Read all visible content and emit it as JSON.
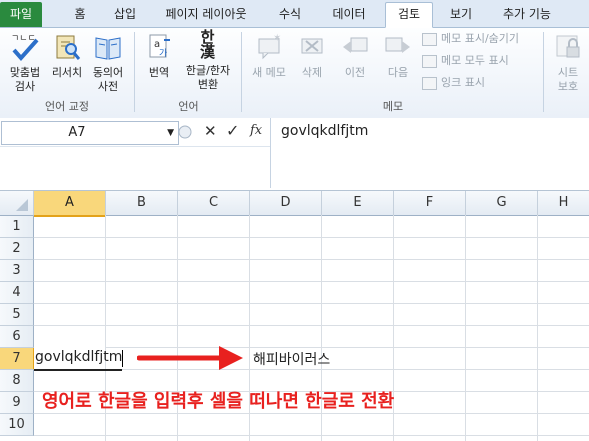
{
  "ribbon_tabs": [
    "파일",
    "홈",
    "삽입",
    "페이지 레이아웃",
    "수식",
    "데이터",
    "검토",
    "보기",
    "추가 기능"
  ],
  "ribbon": {
    "groups": {
      "proofing": {
        "label": "언어 교정",
        "spell_check": "맞춤법\n검사",
        "research": "리서치",
        "thesaurus": "동의어\n사전"
      },
      "language": {
        "label": "언어",
        "translate": "번역",
        "hanja_convert": "한글/한자\n변환",
        "hanja_icon_glyph": "한\n漢"
      },
      "comments": {
        "label": "메모",
        "new_comment": "새 메모",
        "delete": "삭제",
        "previous": "이전",
        "next": "다음",
        "show_hide": "메모 표시/숨기기",
        "show_all": "메모 모두 표시",
        "show_ink": "잉크 표시"
      },
      "changes": {
        "protect_sheet": "시트\n보호"
      }
    }
  },
  "formula_bar": {
    "name_box": "A7",
    "cancel_glyph": "✕",
    "enter_glyph": "✓",
    "fx_label": "fx",
    "formula": "govlqkdlfjtm"
  },
  "sheet": {
    "columns": [
      "A",
      "B",
      "C",
      "D",
      "E",
      "F",
      "G",
      "H"
    ],
    "rows": [
      "1",
      "2",
      "3",
      "4",
      "5",
      "6",
      "7",
      "8",
      "9",
      "10"
    ],
    "selected_cell": "A7",
    "cells": {
      "A7": "govlqkdlfjtm",
      "D7": "해피바이러스"
    }
  },
  "annotation": {
    "text": "영어로 한글을 입력후 셀을 떠나면 한글로 전환",
    "color": "#e8211f"
  },
  "colors": {
    "file_tab": "#2a8a3e",
    "selection_header": "#f9d77b",
    "arrow": "#e8211f"
  }
}
